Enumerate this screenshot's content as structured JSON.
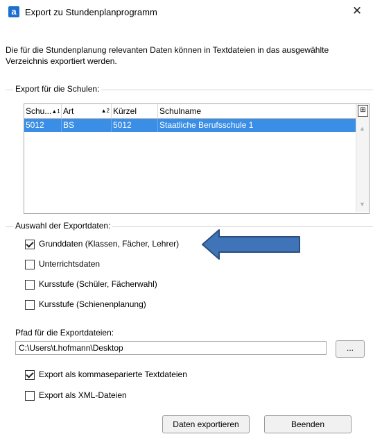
{
  "window": {
    "title": "Export zu Stundenplanprogramm",
    "app_icon_glyph": "a",
    "close_glyph": "✕"
  },
  "description": "Die für die Stundenplanung relevanten Daten können in Textdateien in das ausgewählte Verzeichnis exportiert werden.",
  "schools_group": {
    "label": "Export für die Schulen:",
    "columns": [
      {
        "label": "Schu...",
        "sort": "▲1"
      },
      {
        "label": "Art",
        "sort": "▲2"
      },
      {
        "label": "Kürzel",
        "sort": ""
      },
      {
        "label": "Schulname",
        "sort": ""
      }
    ],
    "rows": [
      {
        "schulnummer": "5012",
        "art": "BS",
        "kuerzel": "5012",
        "schulname": "Staatliche Berufsschule 1",
        "selected": true
      }
    ]
  },
  "export_data_group": {
    "label": "Auswahl der Exportdaten:",
    "options": [
      {
        "label": "Grunddaten (Klassen, Fächer, Lehrer)",
        "checked": true
      },
      {
        "label": "Unterrichtsdaten",
        "checked": false
      },
      {
        "label": "Kursstufe (Schüler, Fächerwahl)",
        "checked": false
      },
      {
        "label": "Kursstufe (Schienenplanung)",
        "checked": false
      }
    ]
  },
  "path": {
    "label": "Pfad für die Exportdateien:",
    "value": "C:\\Users\\t.hofmann\\Desktop",
    "browse_label": "..."
  },
  "format_options": [
    {
      "label": "Export als kommaseparierte Textdateien",
      "checked": true
    },
    {
      "label": "Export als XML-Dateien",
      "checked": false
    }
  ],
  "buttons": {
    "export_label": "Daten exportieren",
    "close_label": "Beenden"
  },
  "colors": {
    "selection": "#3a8ee6",
    "arrow_fill": "#3f74b8",
    "arrow_stroke": "#2b4f80"
  }
}
